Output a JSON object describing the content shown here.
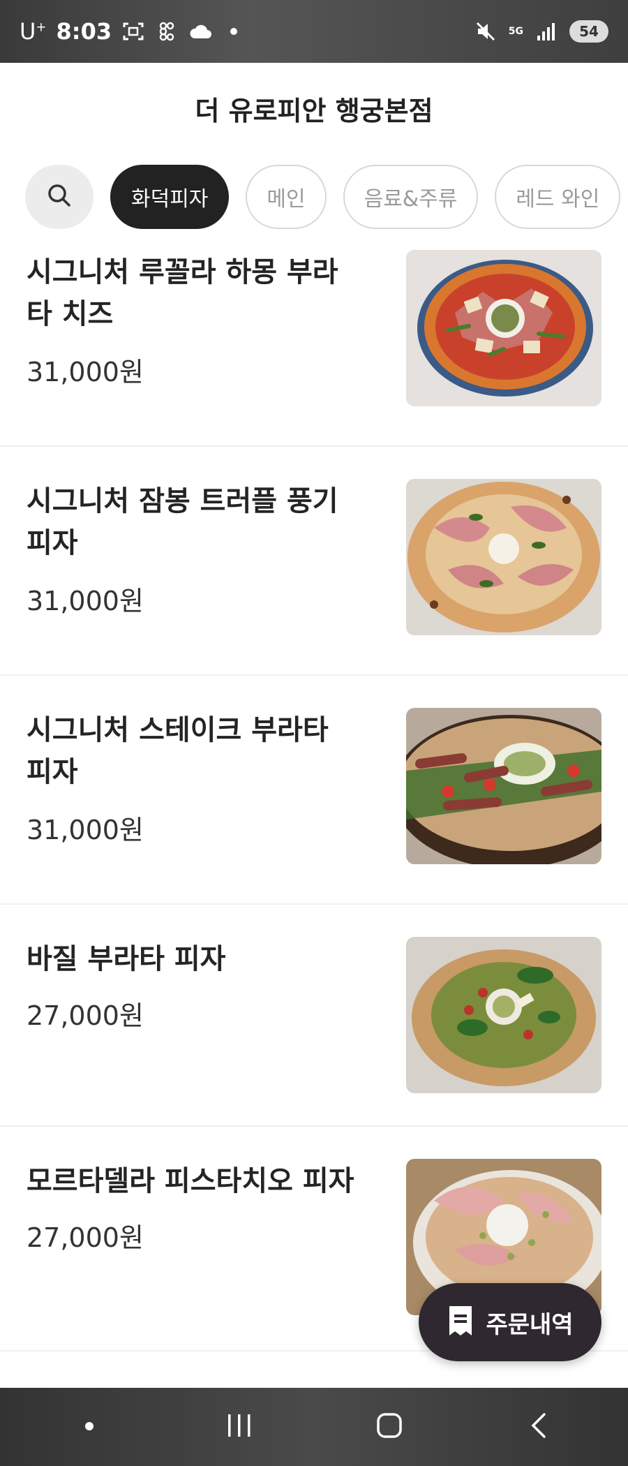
{
  "status_bar": {
    "carrier": "U",
    "carrier_sup": "+",
    "time": "8:03",
    "network": "5G",
    "battery": "54",
    "icons": [
      "screenshot-icon",
      "app-icon",
      "cloud-icon",
      "dot-icon",
      "mute-icon",
      "signal-icon",
      "battery-icon"
    ]
  },
  "header": {
    "title": "더 유로피안 행궁본점"
  },
  "categories": {
    "search_icon": "search-icon",
    "items": [
      {
        "label": "화덕피자",
        "active": true
      },
      {
        "label": "메인",
        "active": false
      },
      {
        "label": "음료&주류",
        "active": false
      },
      {
        "label": "레드 와인",
        "active": false
      }
    ]
  },
  "menu": [
    {
      "name": "시그니처 루꼴라 하몽 부라타 치즈",
      "price": "31,000원"
    },
    {
      "name": "시그니처 잠봉 트러플 풍기피자",
      "price": "31,000원"
    },
    {
      "name": "시그니처 스테이크 부라타 피자",
      "price": "31,000원"
    },
    {
      "name": "바질 부라타 피자",
      "price": "27,000원"
    },
    {
      "name": "모르타델라 피스타치오 피자",
      "price": "27,000원"
    }
  ],
  "order_button": {
    "label": "주문내역",
    "icon": "receipt-icon"
  },
  "nav_bar": {
    "icons": [
      "dot-icon",
      "recent-apps-icon",
      "home-icon",
      "back-icon"
    ]
  },
  "colors": {
    "accent_dark": "#222222",
    "order_button": "#2f2830",
    "chip_border": "#d8d8d8"
  }
}
